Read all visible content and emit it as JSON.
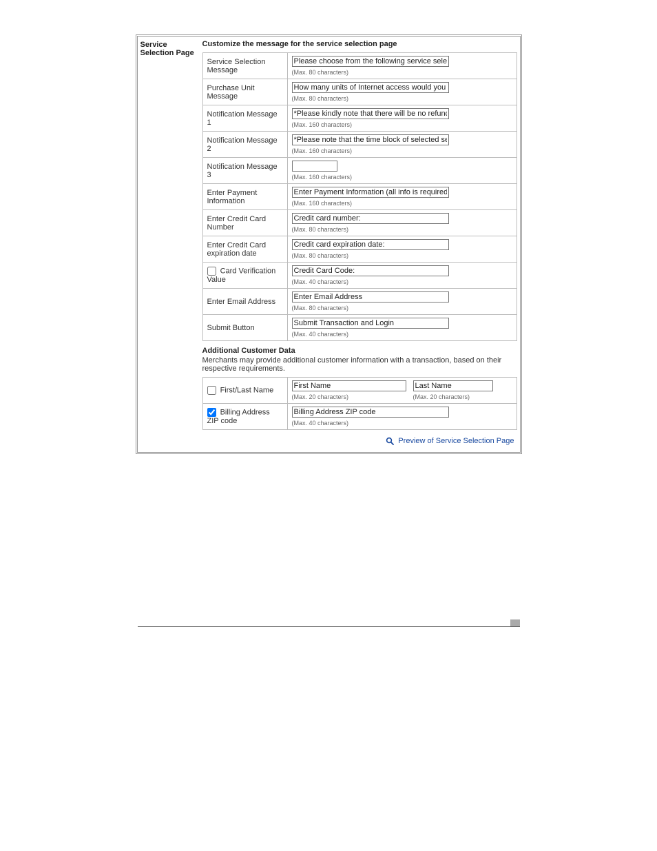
{
  "panel": {
    "title_side": "Service Selection Page",
    "title_head": "Customize the message for the service selection page",
    "rows": [
      {
        "label": "Service Selection Message",
        "value": "Please choose from the following service selection",
        "hint": "(Max. 80 characters)"
      },
      {
        "label": "Purchase Unit Message",
        "value": "How many units of Internet access would you like to",
        "hint": "(Max. 80 characters)"
      },
      {
        "label": "Notification Message 1",
        "value": "*Please kindly note that there will be no refund once",
        "hint": "(Max. 160 characters)"
      },
      {
        "label": "Notification Message 2",
        "value": "*Please note that the time block of selected service",
        "hint": "(Max. 160 characters)"
      },
      {
        "label": "Notification Message 3",
        "value": "",
        "hint": "(Max. 160 characters)"
      },
      {
        "label": "Enter Payment Information",
        "value": "Enter Payment Information (all info is required)",
        "hint": "(Max. 160 characters)"
      },
      {
        "label": "Enter Credit Card Number",
        "value": "Credit card number:",
        "hint": "(Max. 80 characters)"
      },
      {
        "label": "Enter Credit Card expiration date",
        "value": "Credit card expiration date:",
        "hint": "(Max. 80 characters)"
      },
      {
        "label": "Card Verification Value",
        "chk": false,
        "value": "Credit Card Code:",
        "hint": "(Max. 40 characters)"
      },
      {
        "label": "Enter Email Address",
        "value": "Enter Email Address",
        "hint": "(Max. 80 characters)"
      },
      {
        "label": "Submit Button",
        "value": "Submit Transaction and Login",
        "hint": "(Max. 40 characters)"
      }
    ],
    "addl": {
      "heading": "Additional Customer Data",
      "desc": "Merchants may provide additional customer information with a transaction, based on their respective requirements.",
      "rows": [
        {
          "label": "First/Last Name",
          "chk": false,
          "v1": "First Name",
          "h1": "(Max. 20 characters)",
          "v2": "Last Name",
          "h2": "(Max. 20 characters)"
        },
        {
          "label": "Billing Address ZIP code",
          "chk": true,
          "value": "Billing Address ZIP code",
          "hint": "(Max. 40 characters)"
        }
      ]
    },
    "preview_link": "Preview of Service Selection Page"
  }
}
